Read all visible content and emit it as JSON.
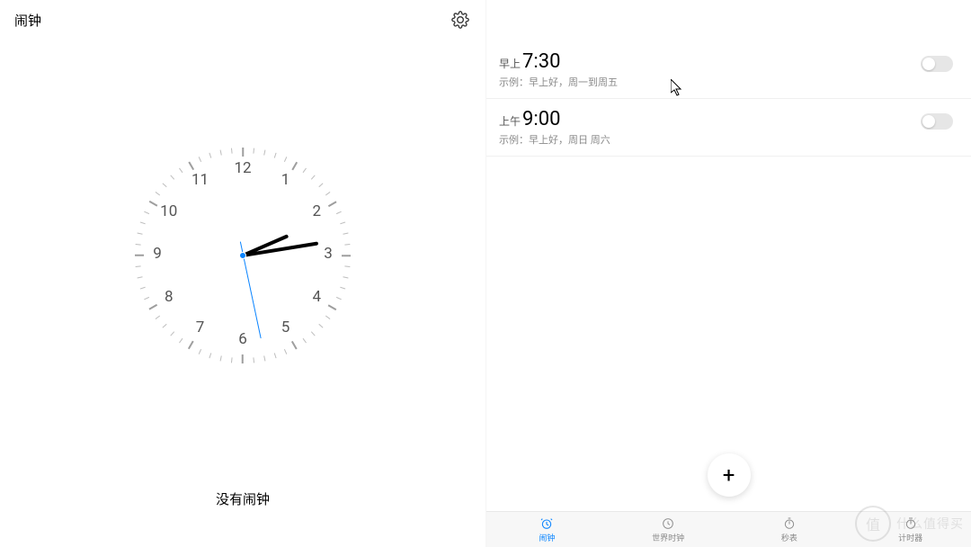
{
  "header": {
    "title": "闹钟",
    "settings_icon": "gear"
  },
  "clock": {
    "time": {
      "hour": 2,
      "minute": 13,
      "second": 28
    },
    "numerals": [
      "12",
      "1",
      "2",
      "3",
      "4",
      "5",
      "6",
      "7",
      "8",
      "9",
      "10",
      "11"
    ]
  },
  "empty_text": "没有闹钟",
  "alarms": [
    {
      "period": "早上",
      "time": "7:30",
      "desc": "示例：早上好，周一到周五",
      "enabled": false
    },
    {
      "period": "上午",
      "time": "9:00",
      "desc": "示例：早上好，周日 周六",
      "enabled": false
    }
  ],
  "fab_label": "+",
  "tabs": [
    {
      "id": "alarm",
      "label": "闹钟",
      "active": true
    },
    {
      "id": "worldclock",
      "label": "世界时钟",
      "active": false
    },
    {
      "id": "stopwatch",
      "label": "秒表",
      "active": false
    },
    {
      "id": "timer",
      "label": "计时器",
      "active": false
    }
  ],
  "watermark": {
    "badge": "值",
    "text": "什么值得买"
  }
}
